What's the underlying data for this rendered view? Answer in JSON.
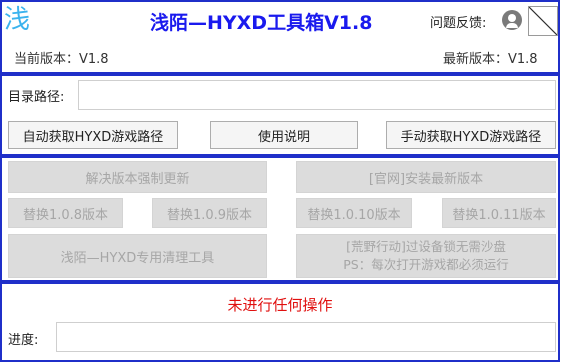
{
  "header": {
    "logo_char": "浅",
    "title": "浅陌—HYXD工具箱V1.8",
    "feedback_label": "问题反馈:",
    "current_version": "当前版本：V1.8",
    "latest_version": "最新版本：V1.8"
  },
  "path": {
    "label": "目录路径:",
    "value": "",
    "auto_button": "自动获取HYXD游戏路径",
    "help_button": "使用说明",
    "manual_button": "手动获取HYXD游戏路径"
  },
  "actions": {
    "fix_update": "解决版本强制更新",
    "official_install": "[官网]安装最新版本",
    "replace_108": "替换1.0.8版本",
    "replace_109": "替换1.0.9版本",
    "replace_1010": "替换1.0.10版本",
    "replace_1011": "替换1.0.11版本",
    "cleaner": "浅陌—HYXD专用清理工具",
    "bypass_line1": "[荒野行动]过设备锁无需沙盘",
    "bypass_line2": "PS：每次打开游戏都必须运行"
  },
  "status": {
    "message": "未进行任何操作",
    "progress_label": "进度:",
    "progress_value": ""
  },
  "colors": {
    "border": "#1f2fc9",
    "title": "#1a1aee",
    "logo": "#3bb3ee",
    "status": "#e0100f"
  }
}
